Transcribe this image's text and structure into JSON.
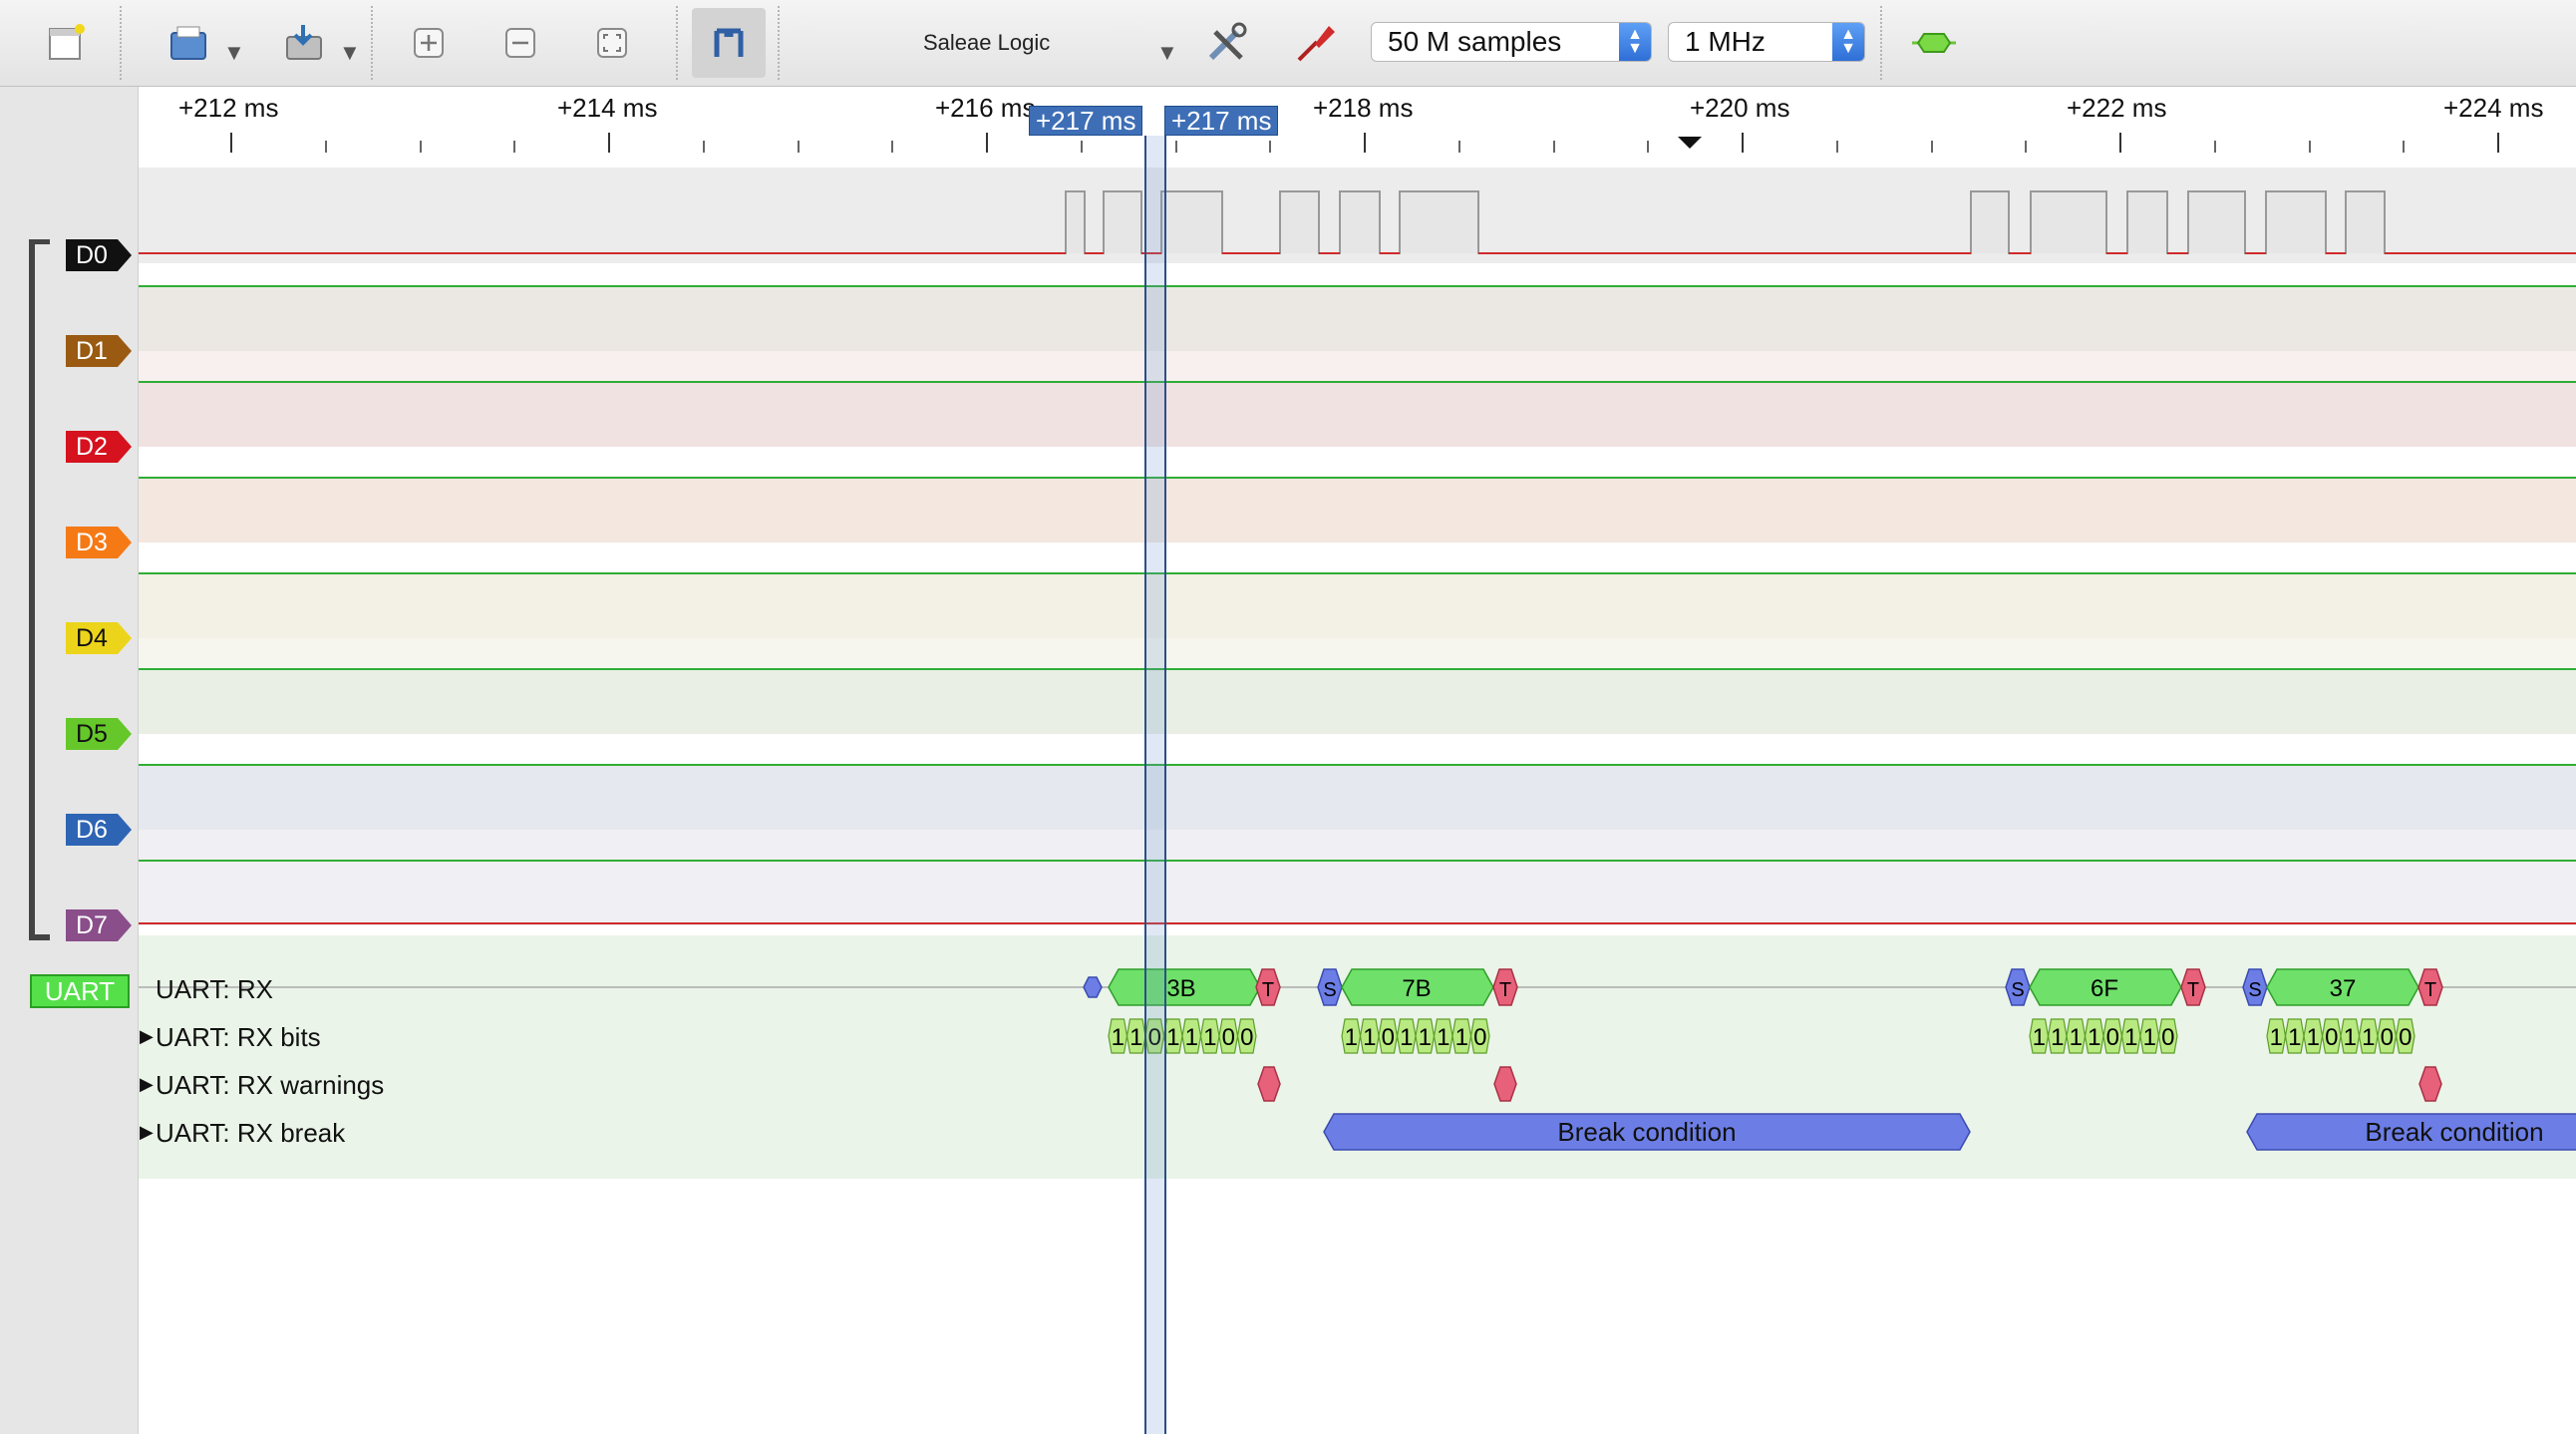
{
  "toolbar": {
    "device_name": "Saleae Logic",
    "samples": "50 M samples",
    "sample_rate": "1 MHz"
  },
  "ruler": {
    "ticks": [
      "+212 ms",
      "+214 ms",
      "+216 ms",
      "+218 ms",
      "+220 ms",
      "+222 ms",
      "+224 ms"
    ],
    "cursor_left": "+217 ms",
    "cursor_right": "+217 ms"
  },
  "channels": [
    {
      "label": "D0",
      "color": "#111111"
    },
    {
      "label": "D1",
      "color": "#9a5a12"
    },
    {
      "label": "D2",
      "color": "#d5121e"
    },
    {
      "label": "D3",
      "color": "#f57a16"
    },
    {
      "label": "D4",
      "color": "#ecd41a"
    },
    {
      "label": "D5",
      "color": "#65c72a"
    },
    {
      "label": "D6",
      "color": "#2e64b4"
    },
    {
      "label": "D7",
      "color": "#8a4e8a"
    }
  ],
  "analyzer": {
    "tag": "UART",
    "rows": [
      {
        "label": "UART: RX"
      },
      {
        "label": "UART: RX bits"
      },
      {
        "label": "UART: RX warnings"
      },
      {
        "label": "UART: RX break"
      }
    ]
  },
  "frames": [
    {
      "start": "",
      "value": "3B",
      "stop": "T",
      "bits": [
        "1",
        "1",
        "0",
        "1",
        "1",
        "1",
        "0",
        "0"
      ]
    },
    {
      "start": "S",
      "value": "7B",
      "stop": "T",
      "bits": [
        "1",
        "1",
        "0",
        "1",
        "1",
        "1",
        "1",
        "0"
      ]
    },
    {
      "start": "S",
      "value": "6F",
      "stop": "T",
      "bits": [
        "1",
        "1",
        "1",
        "1",
        "0",
        "1",
        "1",
        "0"
      ]
    },
    {
      "start": "S",
      "value": "37",
      "stop": "T",
      "bits": [
        "1",
        "1",
        "1",
        "0",
        "1",
        "1",
        "0",
        "0"
      ]
    }
  ],
  "breaks": [
    {
      "label": "Break condition"
    },
    {
      "label": "Break condition"
    }
  ]
}
